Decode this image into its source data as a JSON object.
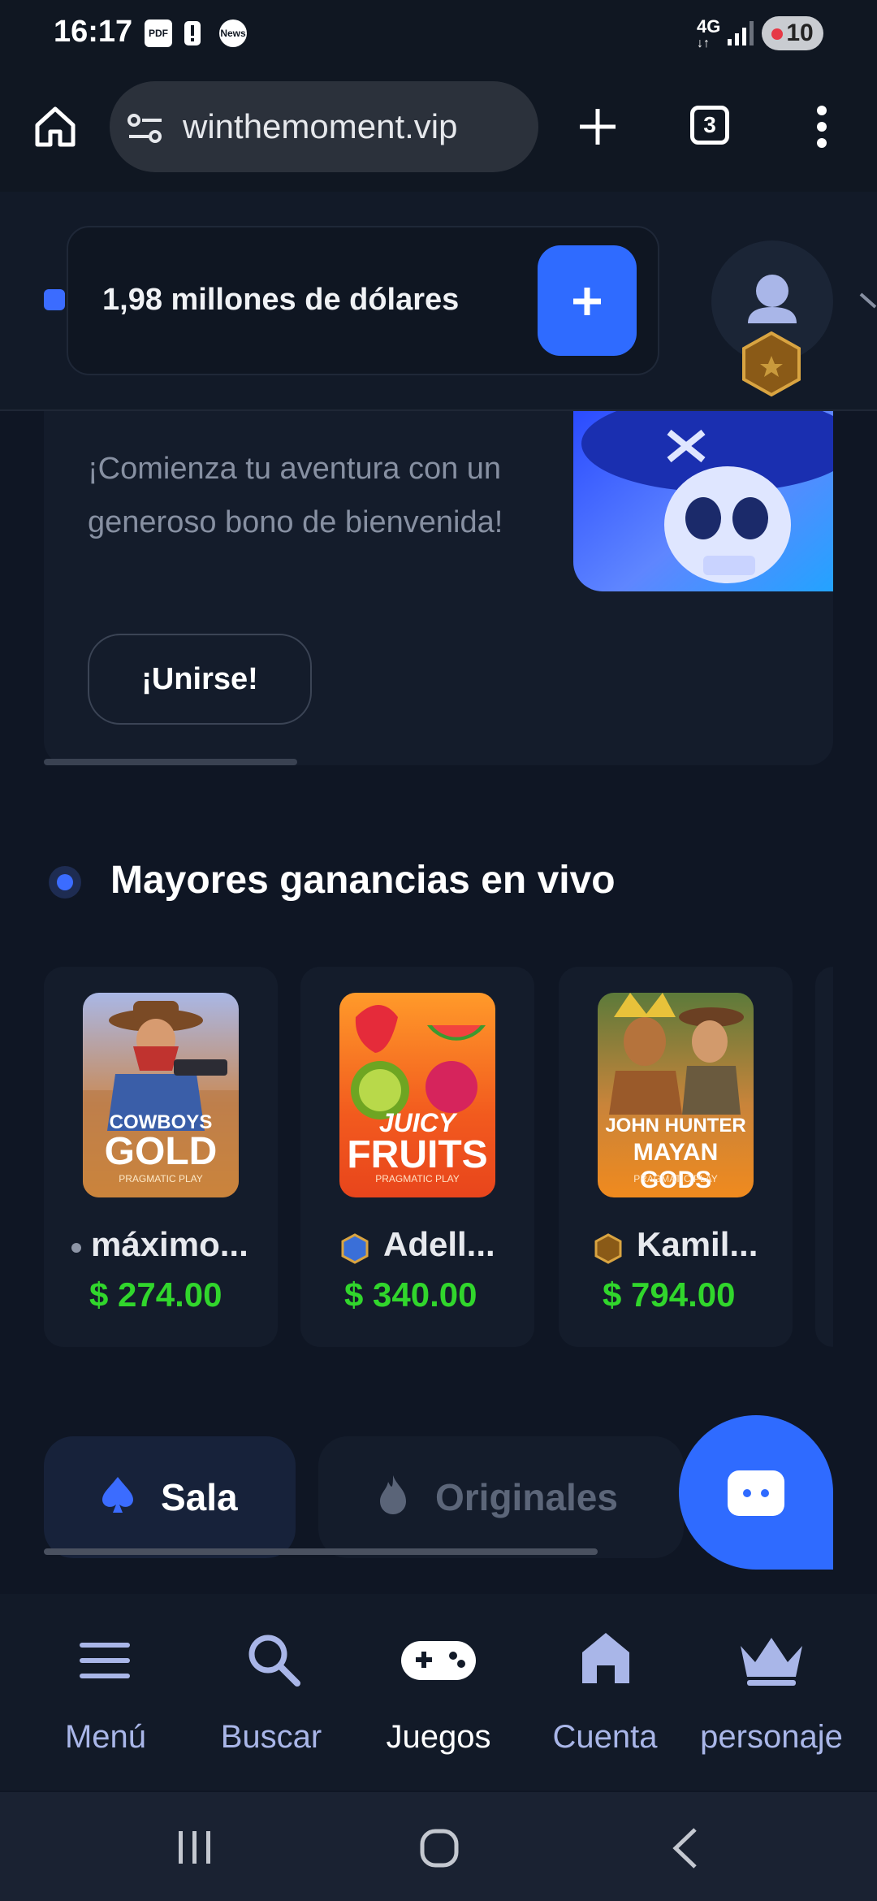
{
  "status_bar": {
    "time": "16:17",
    "icons": [
      "pdf-icon",
      "alert-icon",
      "news-icon"
    ],
    "network": "4G",
    "battery": "10"
  },
  "browser": {
    "url": "winthemoment.vip",
    "tab_count": "3"
  },
  "header": {
    "balance": "1,98 millones de dólares"
  },
  "promo": {
    "text": "¡Comienza tu aventura con un generoso bono de bienvenida!",
    "join_label": "¡Unirse!"
  },
  "live_wins": {
    "title": "Mayores ganancias en vivo",
    "items": [
      {
        "game_line1": "COWBOYS",
        "game_line2": "GOLD",
        "provider": "PRAGMATIC PLAY",
        "player": "máximo...",
        "amount": "$ 274.00"
      },
      {
        "game_line1": "JUICY",
        "game_line2": "FRUITS",
        "provider": "PRAGMATIC PLAY",
        "player": "Adell...",
        "amount": "$ 340.00"
      },
      {
        "game_line1": "JOHN HUNTER",
        "game_line2": "MAYAN GODS",
        "provider": "PRAGMATIC PLAY",
        "player": "Kamil...",
        "amount": "$ 794.00"
      }
    ]
  },
  "tabs": [
    {
      "label": "Sala"
    },
    {
      "label": "Originales"
    }
  ],
  "bottom_nav": [
    {
      "label": "Menú",
      "icon": "menu-icon"
    },
    {
      "label": "Buscar",
      "icon": "search-icon"
    },
    {
      "label": "Juegos",
      "icon": "gamepad-icon"
    },
    {
      "label": "Cuenta",
      "icon": "home-icon"
    },
    {
      "label": "personaje",
      "icon": "crown-icon"
    }
  ],
  "colors": {
    "accent": "#2f6bff",
    "background": "#0f1624",
    "card": "#141c2b",
    "win_green": "#31d62c"
  }
}
